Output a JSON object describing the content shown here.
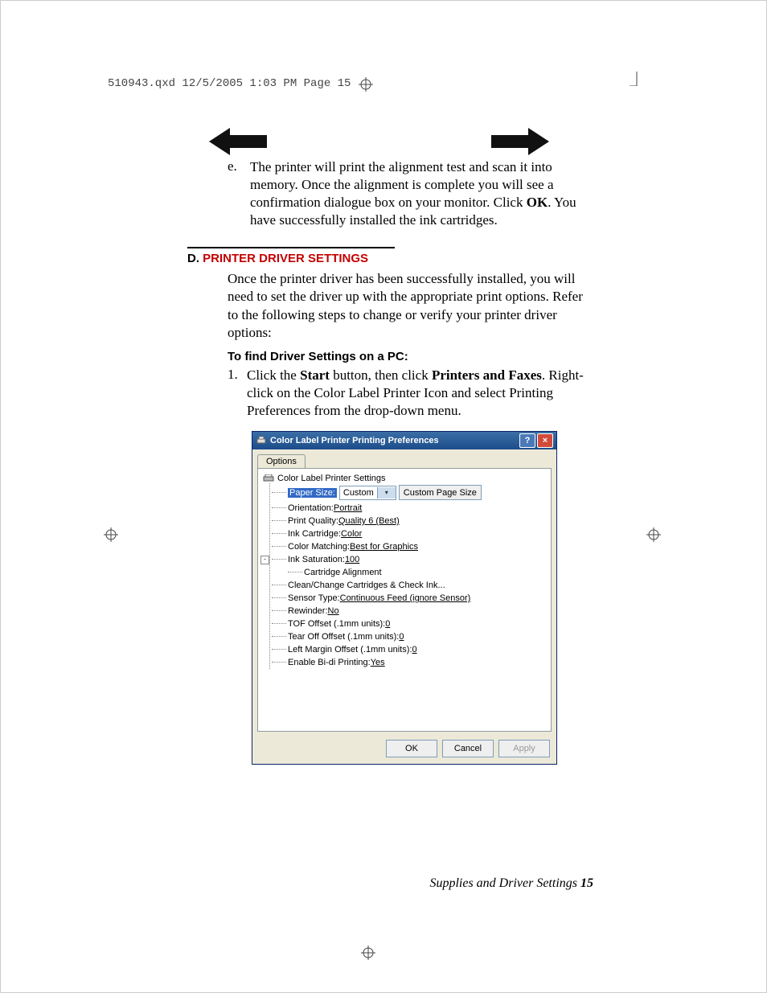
{
  "header_line": "510943.qxd  12/5/2005  1:03 PM  Page 15",
  "list_e": {
    "marker": "e.",
    "pre": "The printer will print the alignment test and scan it into memory.  Once the alignment is complete you will see a confirmation dialogue box on your monitor. Click ",
    "bold": "OK",
    "post": ".  You have successfully installed the ink cartridges."
  },
  "section": {
    "d": "D. ",
    "title": "PRINTER DRIVER SETTINGS"
  },
  "paragraph": "Once the printer driver has been successfully installed, you will need to set the driver up with the appropriate print options.  Refer to the following steps to change or verify your printer driver options:",
  "subheading": "To find Driver Settings on a PC:",
  "list_1": {
    "marker": "1.",
    "t1": "Click the ",
    "b1": "Start",
    "t2": " button, then click ",
    "b2": "Printers and Faxes",
    "t3": ". Right-click on the Color Label Printer Icon and select Printing Preferences from the drop-down menu."
  },
  "dialog": {
    "title": "Color Label Printer Printing Preferences",
    "tab": "Options",
    "root": "Color Label Printer Settings",
    "items": {
      "paper_size_label": "Paper Size:",
      "paper_size_value": "Custom",
      "custom_page_btn": "Custom Page Size",
      "orientation": {
        "label": "Orientation: ",
        "value": "Portrait"
      },
      "print_quality": {
        "label": "Print Quality: ",
        "value": "Quality 6 (Best)"
      },
      "ink_cartridge": {
        "label": "Ink Cartridge: ",
        "value": "Color"
      },
      "color_matching": {
        "label": "Color Matching: ",
        "value": "Best for Graphics"
      },
      "ink_saturation": {
        "label": "Ink Saturation: ",
        "value": "100"
      },
      "cartridge_alignment": "Cartridge Alignment",
      "clean_change": "Clean/Change Cartridges & Check Ink...",
      "sensor_type": {
        "label": "Sensor Type: ",
        "value": "Continuous Feed (ignore Sensor)"
      },
      "rewinder": {
        "label": "Rewinder: ",
        "value": "No"
      },
      "tof_offset": {
        "label": "TOF Offset (.1mm units): ",
        "value": "0"
      },
      "tear_off": {
        "label": "Tear Off Offset (.1mm units): ",
        "value": "0"
      },
      "left_margin": {
        "label": "Left Margin Offset (.1mm units): ",
        "value": "0"
      },
      "enable_bidi": {
        "label": "Enable Bi-di Printing: ",
        "value": "Yes"
      }
    },
    "buttons": {
      "ok": "OK",
      "cancel": "Cancel",
      "apply": "Apply"
    }
  },
  "footer": {
    "text": "Supplies and Driver Settings ",
    "page": "15"
  }
}
